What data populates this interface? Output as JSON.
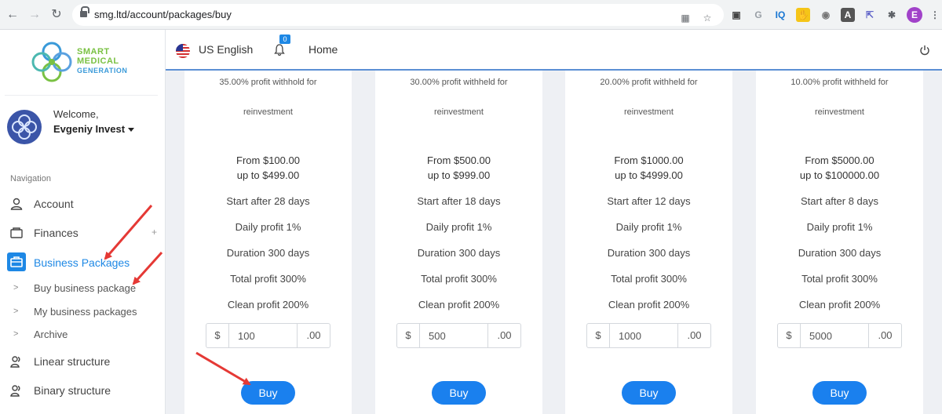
{
  "browser": {
    "url": "smg.ltd/account/packages/buy",
    "profile_initial": "E"
  },
  "logo": {
    "line1": "SMART",
    "line2": "MEDICAL",
    "line3": "GENERATION"
  },
  "user": {
    "welcome": "Welcome,",
    "name": "Evgeniy Invest"
  },
  "topbar": {
    "language": "US English",
    "notifications_count": "0",
    "home": "Home"
  },
  "sidebar": {
    "heading": "Navigation",
    "items": [
      {
        "label": "Account"
      },
      {
        "label": "Finances",
        "toggle": "+"
      },
      {
        "label": "Business Packages",
        "active": true
      },
      {
        "label": "Linear structure"
      },
      {
        "label": "Binary structure"
      }
    ],
    "sub_items": [
      {
        "label": "Buy business package"
      },
      {
        "label": "My business packages"
      },
      {
        "label": "Archive"
      }
    ]
  },
  "packages": [
    {
      "withheld": "35.00% profit withhold for",
      "reinvest": "reinvestment",
      "from": "From $100.00",
      "upto": "up to $499.00",
      "start": "Start after 28 days",
      "daily": "Daily profit 1%",
      "duration": "Duration 300 days",
      "total": "Total profit 300%",
      "clean": "Clean profit 200%",
      "currency": "$",
      "amount": "100",
      "decimals": ".00",
      "buy": "Buy"
    },
    {
      "withheld": "30.00% profit withheld for",
      "reinvest": "reinvestment",
      "from": "From $500.00",
      "upto": "up to $999.00",
      "start": "Start after 18 days",
      "daily": "Daily profit 1%",
      "duration": "Duration 300 days",
      "total": "Total profit 300%",
      "clean": "Clean profit 200%",
      "currency": "$",
      "amount": "500",
      "decimals": ".00",
      "buy": "Buy"
    },
    {
      "withheld": "20.00% profit withheld for",
      "reinvest": "reinvestment",
      "from": "From $1000.00",
      "upto": "up to $4999.00",
      "start": "Start after 12 days",
      "daily": "Daily profit 1%",
      "duration": "Duration 300 days",
      "total": "Total profit 300%",
      "clean": "Clean profit 200%",
      "currency": "$",
      "amount": "1000",
      "decimals": ".00",
      "buy": "Buy"
    },
    {
      "withheld": "10.00% profit withheld for",
      "reinvest": "reinvestment",
      "from": "From $5000.00",
      "upto": "up to $100000.00",
      "start": "Start after 8 days",
      "daily": "Daily profit 1%",
      "duration": "Duration 300 days",
      "total": "Total profit 300%",
      "clean": "Clean profit 200%",
      "currency": "$",
      "amount": "5000",
      "decimals": ".00",
      "buy": "Buy"
    }
  ],
  "colors": {
    "accent": "#1e88e5",
    "button": "#1a80ee",
    "annotation_arrow": "#e53935",
    "logo_green": "#7ac143"
  }
}
